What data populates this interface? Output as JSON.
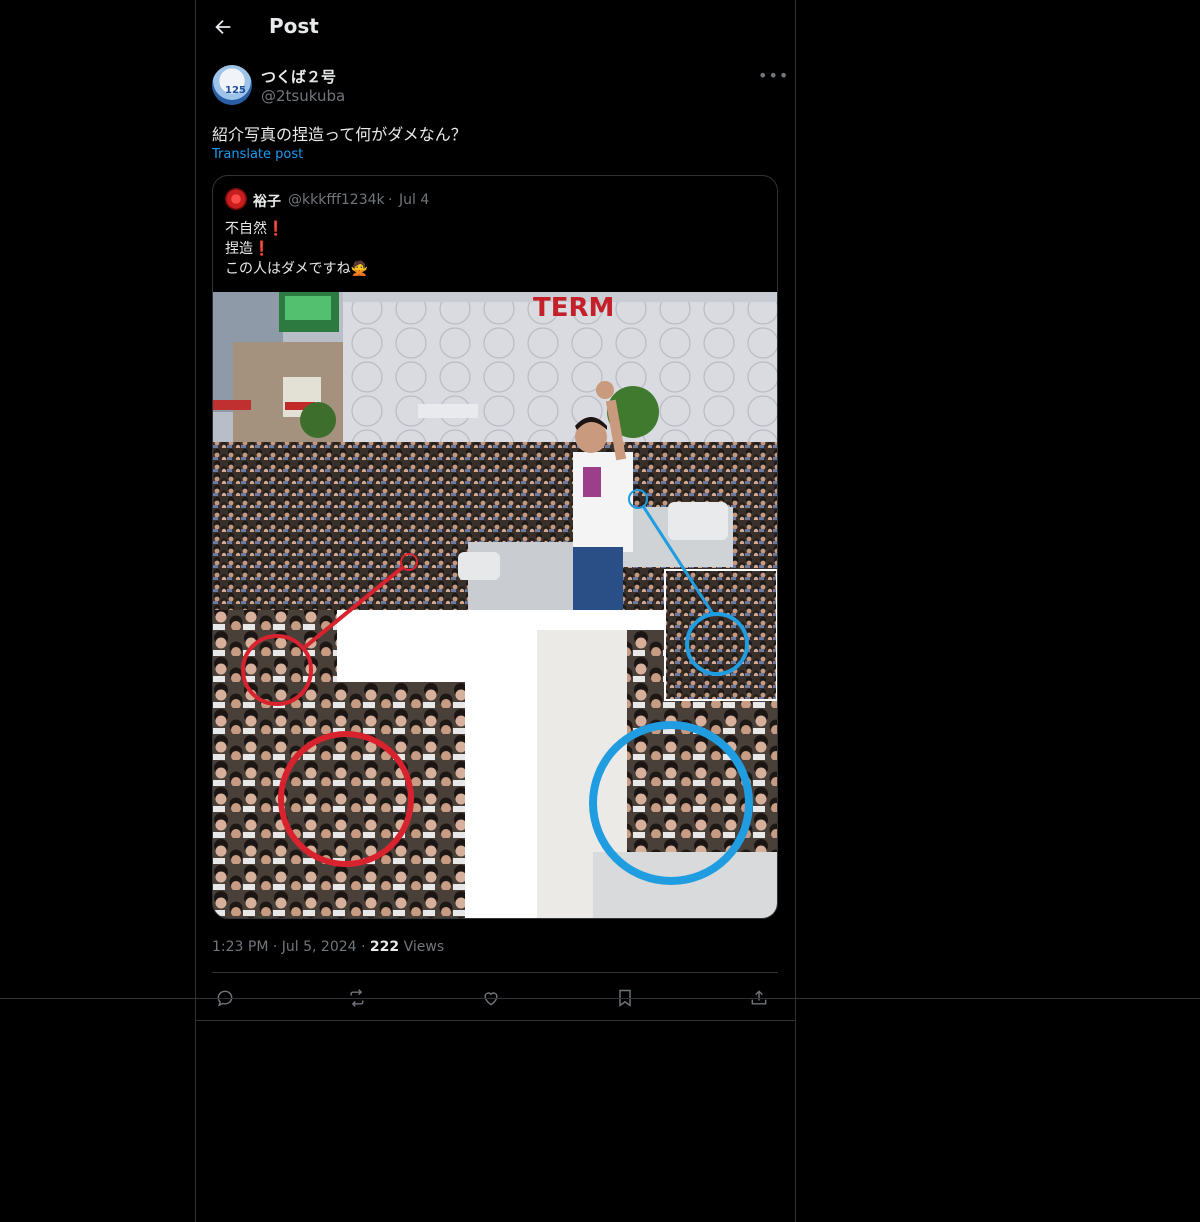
{
  "header": {
    "title": "Post"
  },
  "author": {
    "display_name": "つくば２号",
    "handle": "@2tsukuba",
    "avatar_number": "125"
  },
  "post": {
    "text": "紹介写真の捏造って何がダメなん？",
    "translate_label": "Translate post"
  },
  "quote": {
    "display_name": "裕子",
    "handle": "@kkkfff1234k",
    "separator": "·",
    "date": "Jul 4",
    "lines": [
      {
        "text": "不自然",
        "mark": "❗"
      },
      {
        "text": "捏造",
        "mark": "❗"
      },
      {
        "text": "この人はダメですね",
        "mark": "🙅"
      }
    ],
    "image": {
      "sign_text": "TERM"
    }
  },
  "meta": {
    "time": "1:23 PM",
    "separator": "·",
    "date": "Jul 5, 2024",
    "views_count": "222",
    "views_label": "Views"
  },
  "actions": [
    "reply-icon",
    "repost-icon",
    "like-icon",
    "bookmark-icon",
    "share-icon"
  ],
  "colors": {
    "accent": "#1d9bf0",
    "text": "#e7e9ea",
    "muted": "#71767b",
    "border": "#2f3336",
    "red_circle": "#d8232f",
    "blue_circle": "#1f9de0"
  }
}
